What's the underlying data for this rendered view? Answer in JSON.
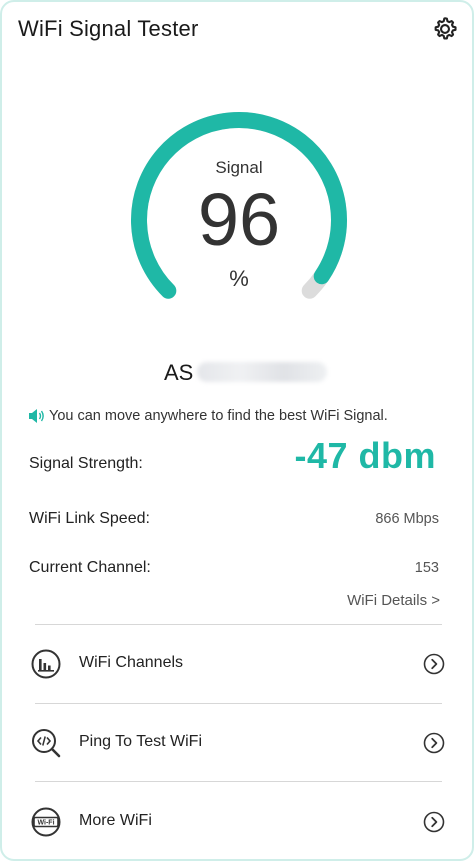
{
  "header": {
    "title": "WiFi Signal Tester",
    "settings_icon": "gear-icon"
  },
  "gauge": {
    "label": "Signal",
    "value": "96",
    "unit": "%",
    "percent": 96,
    "color": "#1fb8a6",
    "track_color": "#dcdcdc"
  },
  "network": {
    "ssid_prefix": "AS"
  },
  "tip": {
    "icon": "speaker-icon",
    "text": "You can move anywhere to find the best WiFi Signal."
  },
  "stats": {
    "strength_label": "Signal Strength:",
    "strength_value": "-47 dbm",
    "speed_label": "WiFi Link Speed:",
    "speed_value": "866 Mbps",
    "channel_label": "Current Channel:",
    "channel_value": "153"
  },
  "details_link": "WiFi Details >",
  "menu": [
    {
      "label": "WiFi Channels",
      "icon": "bar-chart-circle-icon"
    },
    {
      "label": "Ping To Test WiFi",
      "icon": "code-search-icon"
    },
    {
      "label": "More WiFi",
      "icon": "wifi-badge-icon"
    }
  ],
  "accent": "#1fb8a6"
}
